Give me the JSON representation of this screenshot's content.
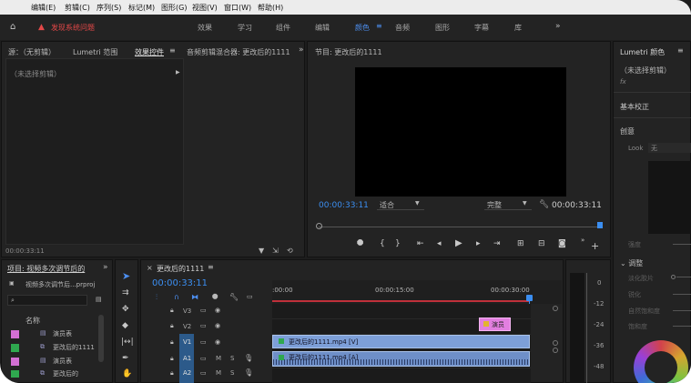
{
  "menubar": {
    "items": [
      "编辑(E)",
      "剪辑(C)",
      "序列(S)",
      "标记(M)",
      "图形(G)",
      "视图(V)",
      "窗口(W)",
      "帮助(H)"
    ]
  },
  "workspace": {
    "warning_label": "发现系统问题",
    "tabs": [
      "效果",
      "学习",
      "组件",
      "编辑",
      "颜色",
      "音频",
      "图形",
      "字幕",
      "库"
    ],
    "active_tab": "颜色"
  },
  "source_panel": {
    "tabs": [
      "源：（无剪辑）",
      "Lumetri 范围",
      "效果控件",
      "音频剪辑混合器: 更改后的1111"
    ],
    "clip_label": "（未选择剪辑）",
    "timecode": "00:00:33:11"
  },
  "program_panel": {
    "title": "节目: 更改后的1111",
    "timecode_left": "00:00:33:11",
    "fit_value": "适合",
    "quality_value": "完整",
    "timecode_right": "00:00:33:11"
  },
  "lumetri": {
    "title": "Lumetri 颜色",
    "clip_label": "（未选择剪辑）",
    "fx_label": "fx",
    "basic_correction": "基本校正",
    "creative": "创意",
    "look_label": "Look",
    "look_value": "无",
    "intensity": "强度",
    "adjust": "调整",
    "sliders": [
      "淡化胶片",
      "锐化",
      "自然饱和度",
      "饱和度"
    ]
  },
  "project_panel": {
    "title": "项目: 视频多次调节后的",
    "file": "视频多次调节后...prproj",
    "column_name": "名称",
    "items": [
      {
        "name": "演员表",
        "color": "#d36fd3"
      },
      {
        "name": "更改后的1111",
        "color": "#2fa84f"
      },
      {
        "name": "演员表",
        "color": "#d36fd3"
      },
      {
        "name": "更改后的",
        "color": "#2fa84f"
      }
    ]
  },
  "timeline": {
    "sequence_tab": "更改后的1111",
    "timecode": "00:00:33:11",
    "ruler_labels": [
      ":00:00",
      "00:00:15:00",
      "00:00:30:00"
    ],
    "tracks": [
      {
        "name": "V3",
        "type": "video"
      },
      {
        "name": "V2",
        "type": "video"
      },
      {
        "name": "V1",
        "type": "video"
      },
      {
        "name": "A1",
        "type": "audio"
      },
      {
        "name": "A2",
        "type": "audio"
      }
    ],
    "clips": {
      "title_clip": "演员",
      "video_clip": "更改后的1111.mp4 [V]",
      "audio_clip": "更改后的1111.mp4 [A]"
    },
    "track_letters": {
      "m": "M",
      "s": "S"
    }
  },
  "meter": {
    "labels": [
      "0",
      "-12",
      "-24",
      "-36",
      "-48"
    ]
  }
}
